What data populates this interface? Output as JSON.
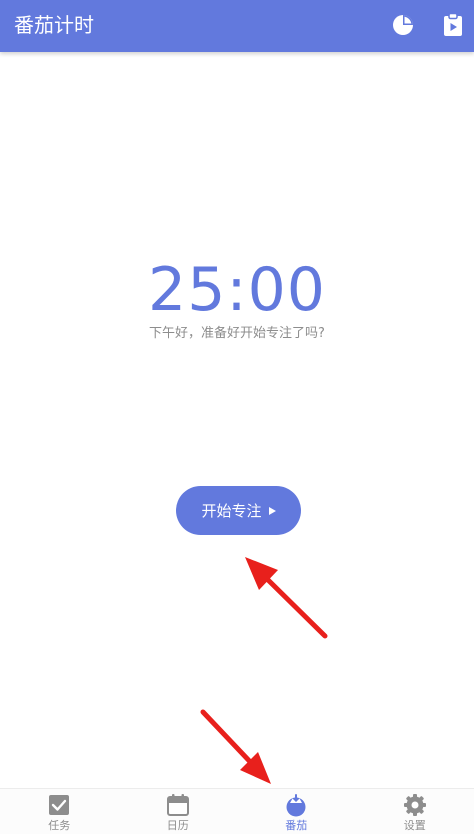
{
  "theme": {
    "accent": "#6279dd",
    "inactive": "#8d8d8d",
    "annotation": "#e8201c"
  },
  "app_bar": {
    "title": "番茄计时",
    "actions": [
      {
        "icon": "pie-chart-icon"
      },
      {
        "icon": "clipboard-play-icon"
      }
    ]
  },
  "timer": {
    "time": "25:00",
    "greeting": "下午好，准备好开始专注了吗?"
  },
  "start_button": {
    "label": "开始专注",
    "icon": "play-icon"
  },
  "bottom_nav": {
    "items": [
      {
        "label": "任务",
        "icon": "checkbox-icon",
        "active": false
      },
      {
        "label": "日历",
        "icon": "calendar-icon",
        "active": false
      },
      {
        "label": "番茄",
        "icon": "tomato-icon",
        "active": true
      },
      {
        "label": "设置",
        "icon": "gear-icon",
        "active": false
      }
    ]
  },
  "annotations": [
    {
      "icon": "red-arrow-icon",
      "points_to": "start-button"
    },
    {
      "icon": "red-arrow-icon",
      "points_to": "nav-item-tomato"
    }
  ]
}
